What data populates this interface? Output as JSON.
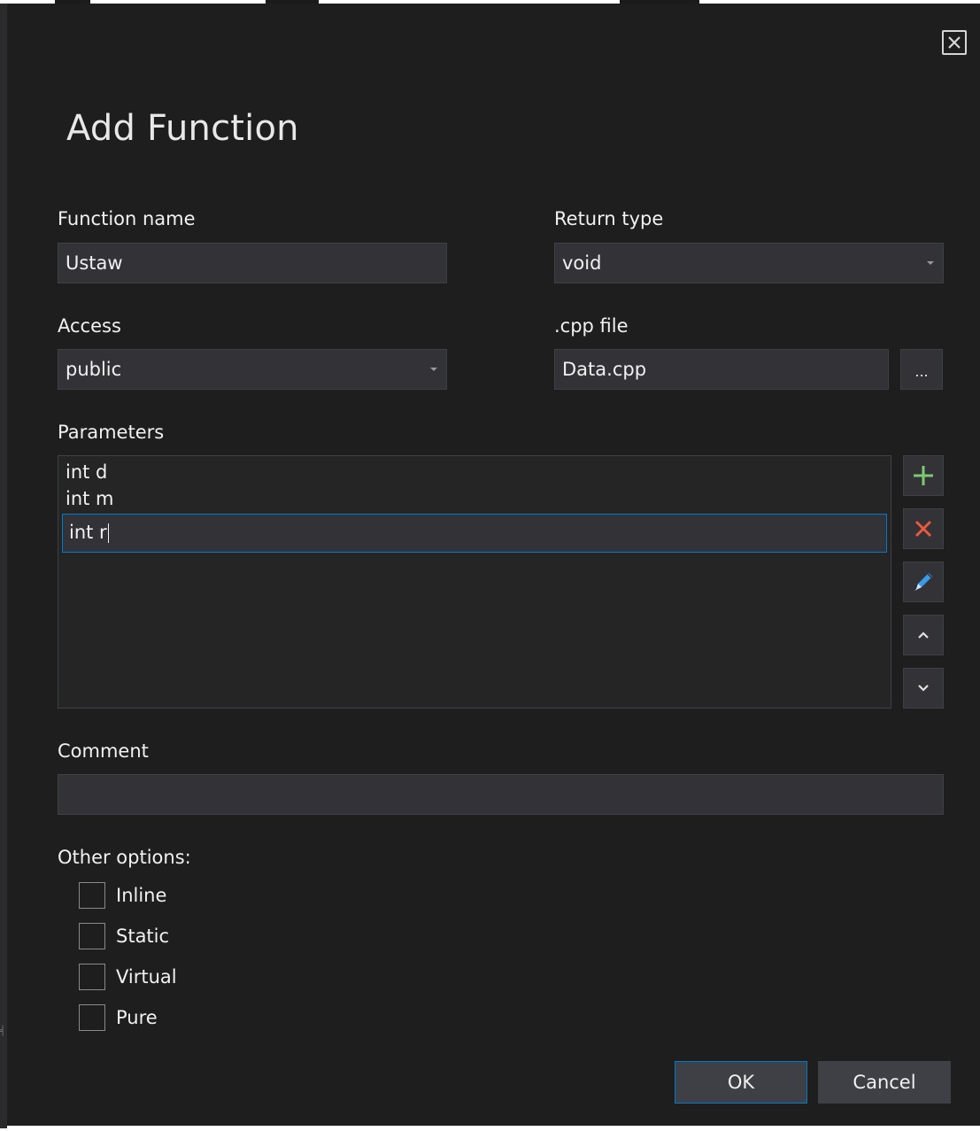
{
  "dialog": {
    "title": "Add Function",
    "close_icon": "close-icon"
  },
  "function_name": {
    "label": "Function name",
    "value": "Ustaw"
  },
  "return_type": {
    "label": "Return type",
    "value": "void"
  },
  "access": {
    "label": "Access",
    "value": "public"
  },
  "cpp_file": {
    "label": ".cpp file",
    "value": "Data.cpp",
    "browse_label": "..."
  },
  "parameters": {
    "label": "Parameters",
    "items": [
      "int d",
      "int m"
    ],
    "editing_value": "int r",
    "buttons": {
      "add_icon": "plus-icon",
      "remove_icon": "delete-icon",
      "edit_icon": "pencil-icon",
      "up_icon": "chevron-up-icon",
      "down_icon": "chevron-down-icon"
    }
  },
  "comment": {
    "label": "Comment",
    "value": ""
  },
  "other_options": {
    "label": "Other options:",
    "options": [
      {
        "label": "Inline",
        "checked": false
      },
      {
        "label": "Static",
        "checked": false
      },
      {
        "label": "Virtual",
        "checked": false
      },
      {
        "label": "Pure",
        "checked": false
      }
    ]
  },
  "footer": {
    "ok_label": "OK",
    "cancel_label": "Cancel"
  },
  "colors": {
    "background": "#1e1e1f",
    "field": "#333337",
    "accent": "#007acc",
    "add_green": "#7ec872",
    "remove_red": "#e8593f",
    "edit_blue": "#3c9be8"
  }
}
